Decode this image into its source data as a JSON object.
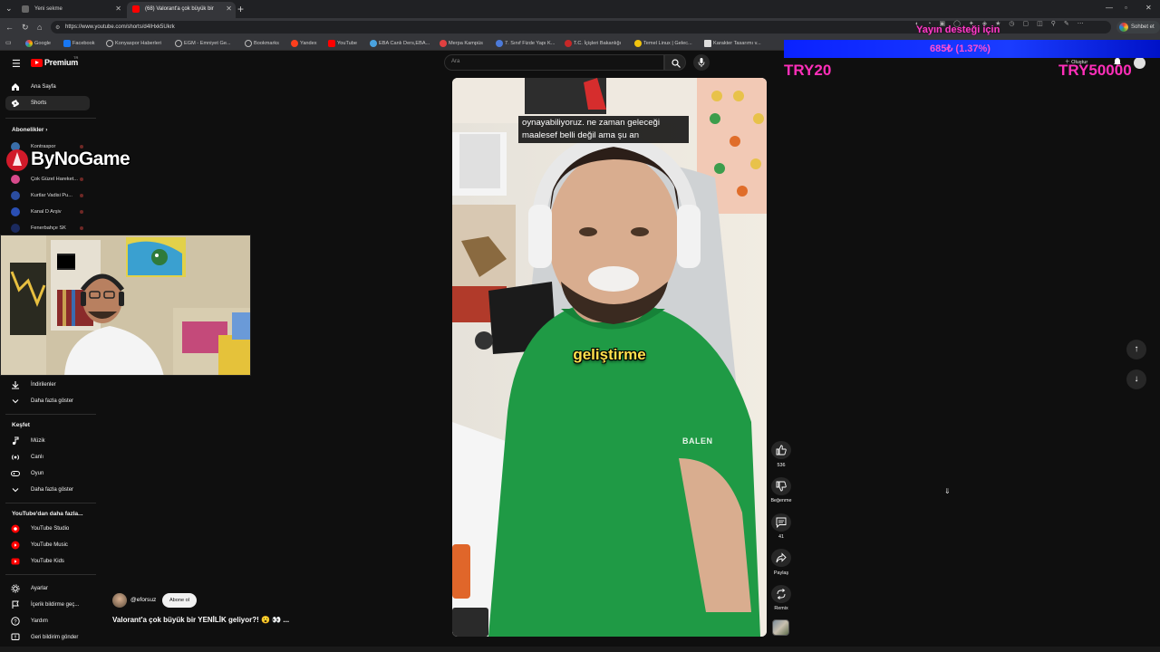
{
  "browser": {
    "tabs": [
      {
        "title": "Yeni sekme"
      },
      {
        "title": "(68) Valorant'a çok büyük bir"
      }
    ],
    "url": "https://www.youtube.com/shorts/d4IHxk5Ukrk",
    "profile_label": "Sohbet et",
    "bookmarks": [
      "Google",
      "Facebook",
      "Konyaspor Haberleri",
      "EGM - Emniyet Ge...",
      "Bookmarks",
      "Yandex",
      "YouTube",
      "EBA Canlı Ders,EBA...",
      "Merpa Kampüs",
      "7. Sınıf Fizde Yapı K...",
      "T.C. İçişleri Bakanlığı",
      "Temel Linux | Gelec...",
      "Karakter Tasarımı v..."
    ]
  },
  "header": {
    "brand": "Premium",
    "region": "TR",
    "search_placeholder": "Ara",
    "create_label": "Oluştur"
  },
  "sidebar": {
    "main": [
      {
        "label": "Ana Sayfa"
      },
      {
        "label": "Shorts"
      }
    ],
    "subscriptions_title": "Abonelikler",
    "subscriptions": [
      {
        "label": "Kontraspor"
      },
      {
        "label": ""
      },
      {
        "label": "Çok Güzel Hareket..."
      },
      {
        "label": "Kurtlar Vadisi Pu..."
      },
      {
        "label": "Kanal D Arşiv"
      },
      {
        "label": "Fenerbahçe SK"
      }
    ],
    "downloads": "İndirilenler",
    "show_more": "Daha fazla göster",
    "explore_title": "Keşfet",
    "explore": [
      {
        "label": "Müzik"
      },
      {
        "label": "Canlı"
      },
      {
        "label": "Oyun"
      }
    ],
    "explore_more": "Daha fazla göster",
    "more_from_title": "YouTube'dan daha fazla...",
    "more_from": [
      {
        "label": "YouTube Studio"
      },
      {
        "label": "YouTube Music"
      },
      {
        "label": "YouTube Kids"
      }
    ],
    "footer": [
      {
        "label": "Ayarlar"
      },
      {
        "label": "İçerik bildirme geç..."
      },
      {
        "label": "Yardım"
      },
      {
        "label": "Geri bildirim gönder"
      }
    ]
  },
  "overlay": {
    "logo_text": "ByNoGame",
    "donation_title": "Yayın desteği için",
    "donation_amount": "685₺ (1.37%)",
    "donation_min": "TRY20",
    "donation_max": "TRY50000"
  },
  "short": {
    "caption_line1": "oynayabiliyoruz. ne zaman geleceği",
    "caption_line2": "maalesef belli değil ama şu an",
    "big_word": "geliştirme",
    "shirt_text": "BALEN",
    "channel": "@eforsuz",
    "subscribe_label": "Abone ol",
    "title": "Valorant'a çok büyük bir YENİLİK geliyor?! 😮 👀 ...",
    "likes": "536",
    "dislike_label": "Beğenme",
    "comments": "41",
    "share_label": "Paylaş",
    "remix_label": "Remix"
  }
}
